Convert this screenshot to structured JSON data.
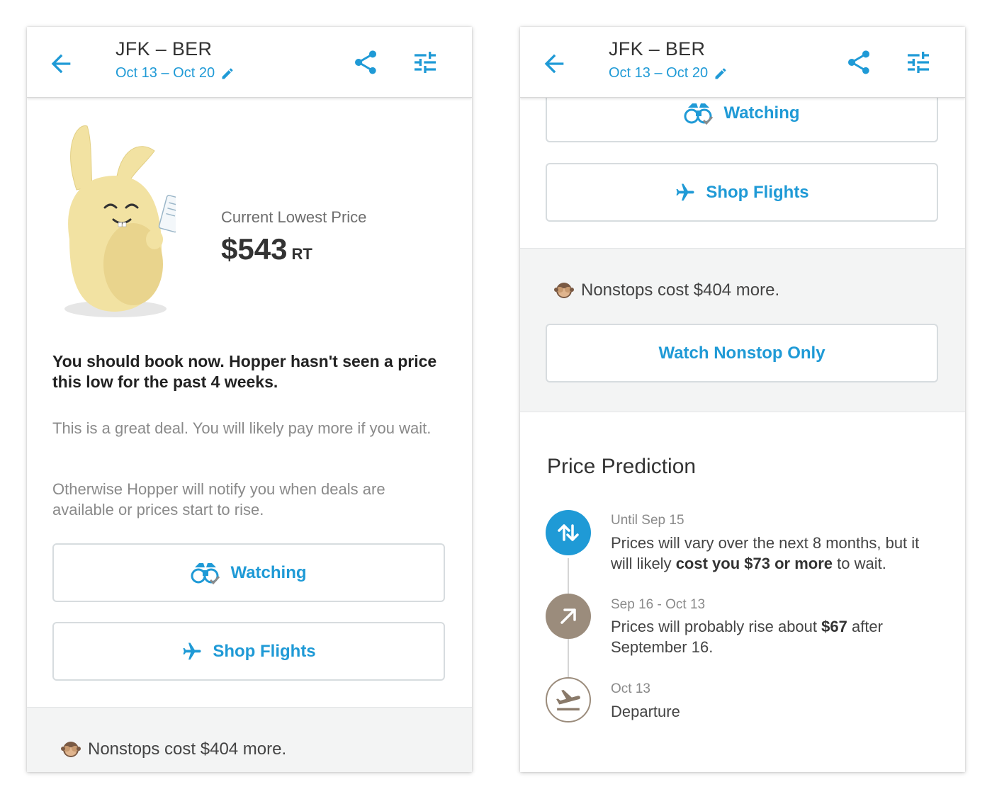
{
  "colors": {
    "accent": "#1f9ad6",
    "rise": "#9b8c7c",
    "band": "#f3f4f4"
  },
  "header": {
    "route": "JFK – BER",
    "dates": "Oct 13 – Oct 20"
  },
  "left": {
    "price_label": "Current Lowest Price",
    "price_value": "$543",
    "price_suffix": "RT",
    "headline": "You should book now. Hopper hasn't seen a price this low for the past 4 weeks.",
    "para1": "This is a great deal. You will likely pay more if you wait.",
    "para2": "Otherwise Hopper will notify you when deals are available or prices start to rise.",
    "watching_label": "Watching",
    "shop_label": "Shop Flights",
    "nonstop_text": "Nonstops cost $404 more."
  },
  "right": {
    "watching_label": "Watching",
    "shop_label": "Shop Flights",
    "nonstop_text": "Nonstops cost $404 more.",
    "watch_nonstop_label": "Watch Nonstop Only",
    "section_title": "Price Prediction",
    "timeline": [
      {
        "icon": "vary-arrows-icon",
        "date": "Until Sep 15",
        "text_pre": "Prices will vary over the next 8 months, but it will likely ",
        "text_bold": "cost you $73 or more",
        "text_post": " to wait."
      },
      {
        "icon": "rise-arrow-icon",
        "date": "Sep 16 - Oct 13",
        "text_pre": "Prices will probably rise about ",
        "text_bold": "$67",
        "text_post": " after September 16."
      },
      {
        "icon": "departure-plane-icon",
        "date": "Oct 13",
        "text_pre": "Departure",
        "text_bold": "",
        "text_post": ""
      }
    ]
  }
}
